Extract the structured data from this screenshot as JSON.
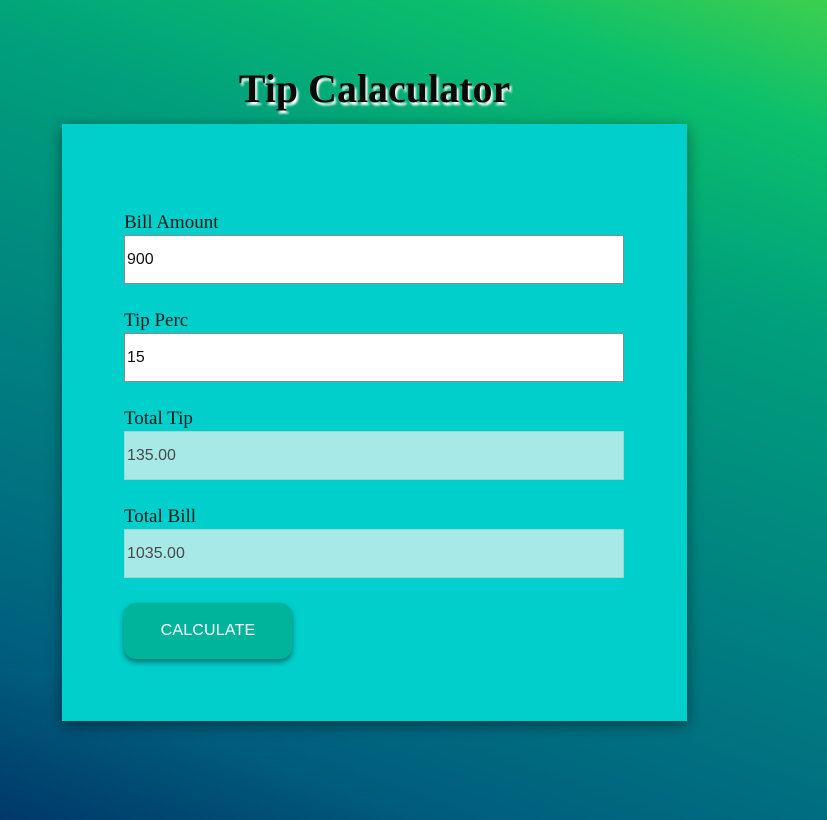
{
  "app": {
    "title": "Tip Calaculator"
  },
  "form": {
    "bill_amount": {
      "label": "Bill Amount",
      "value": "900"
    },
    "tip_perc": {
      "label": "Tip Perc",
      "value": "15"
    },
    "total_tip": {
      "label": "Total Tip",
      "value": "135.00"
    },
    "total_bill": {
      "label": "Total Bill",
      "value": "1035.00"
    },
    "calculate_label": "CALCULATE"
  },
  "colors": {
    "card": "#00cfcb",
    "readonly_field": "#a7e9e6",
    "button": "#00b39b"
  }
}
